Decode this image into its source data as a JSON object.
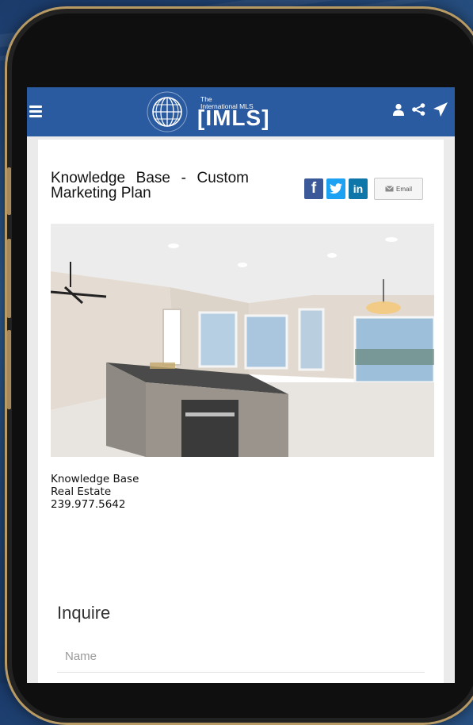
{
  "header": {
    "logo_small_line1": "The",
    "logo_small_line2": "International MLS",
    "logo_big": "[IMLS]",
    "colors": {
      "navbar": "#2a5aa0",
      "icons": "#ffffff"
    },
    "icons": [
      "menu-icon",
      "user-icon",
      "share-icon",
      "send-icon"
    ]
  },
  "listing": {
    "title": "Knowledge Base - Custom Marketing Plan",
    "share": {
      "facebook_label": "f",
      "twitter_label": "t",
      "linkedin_label": "in",
      "email_label": "Email",
      "colors": {
        "facebook": "#3b5998",
        "twitter": "#1da1f2",
        "linkedin": "#0e76a8"
      }
    },
    "agent_name": "Knowledge Base",
    "agent_company": "Real Estate",
    "agent_phone": "239.977.5642"
  },
  "inquire": {
    "title": "Inquire",
    "name_placeholder": "Name"
  }
}
